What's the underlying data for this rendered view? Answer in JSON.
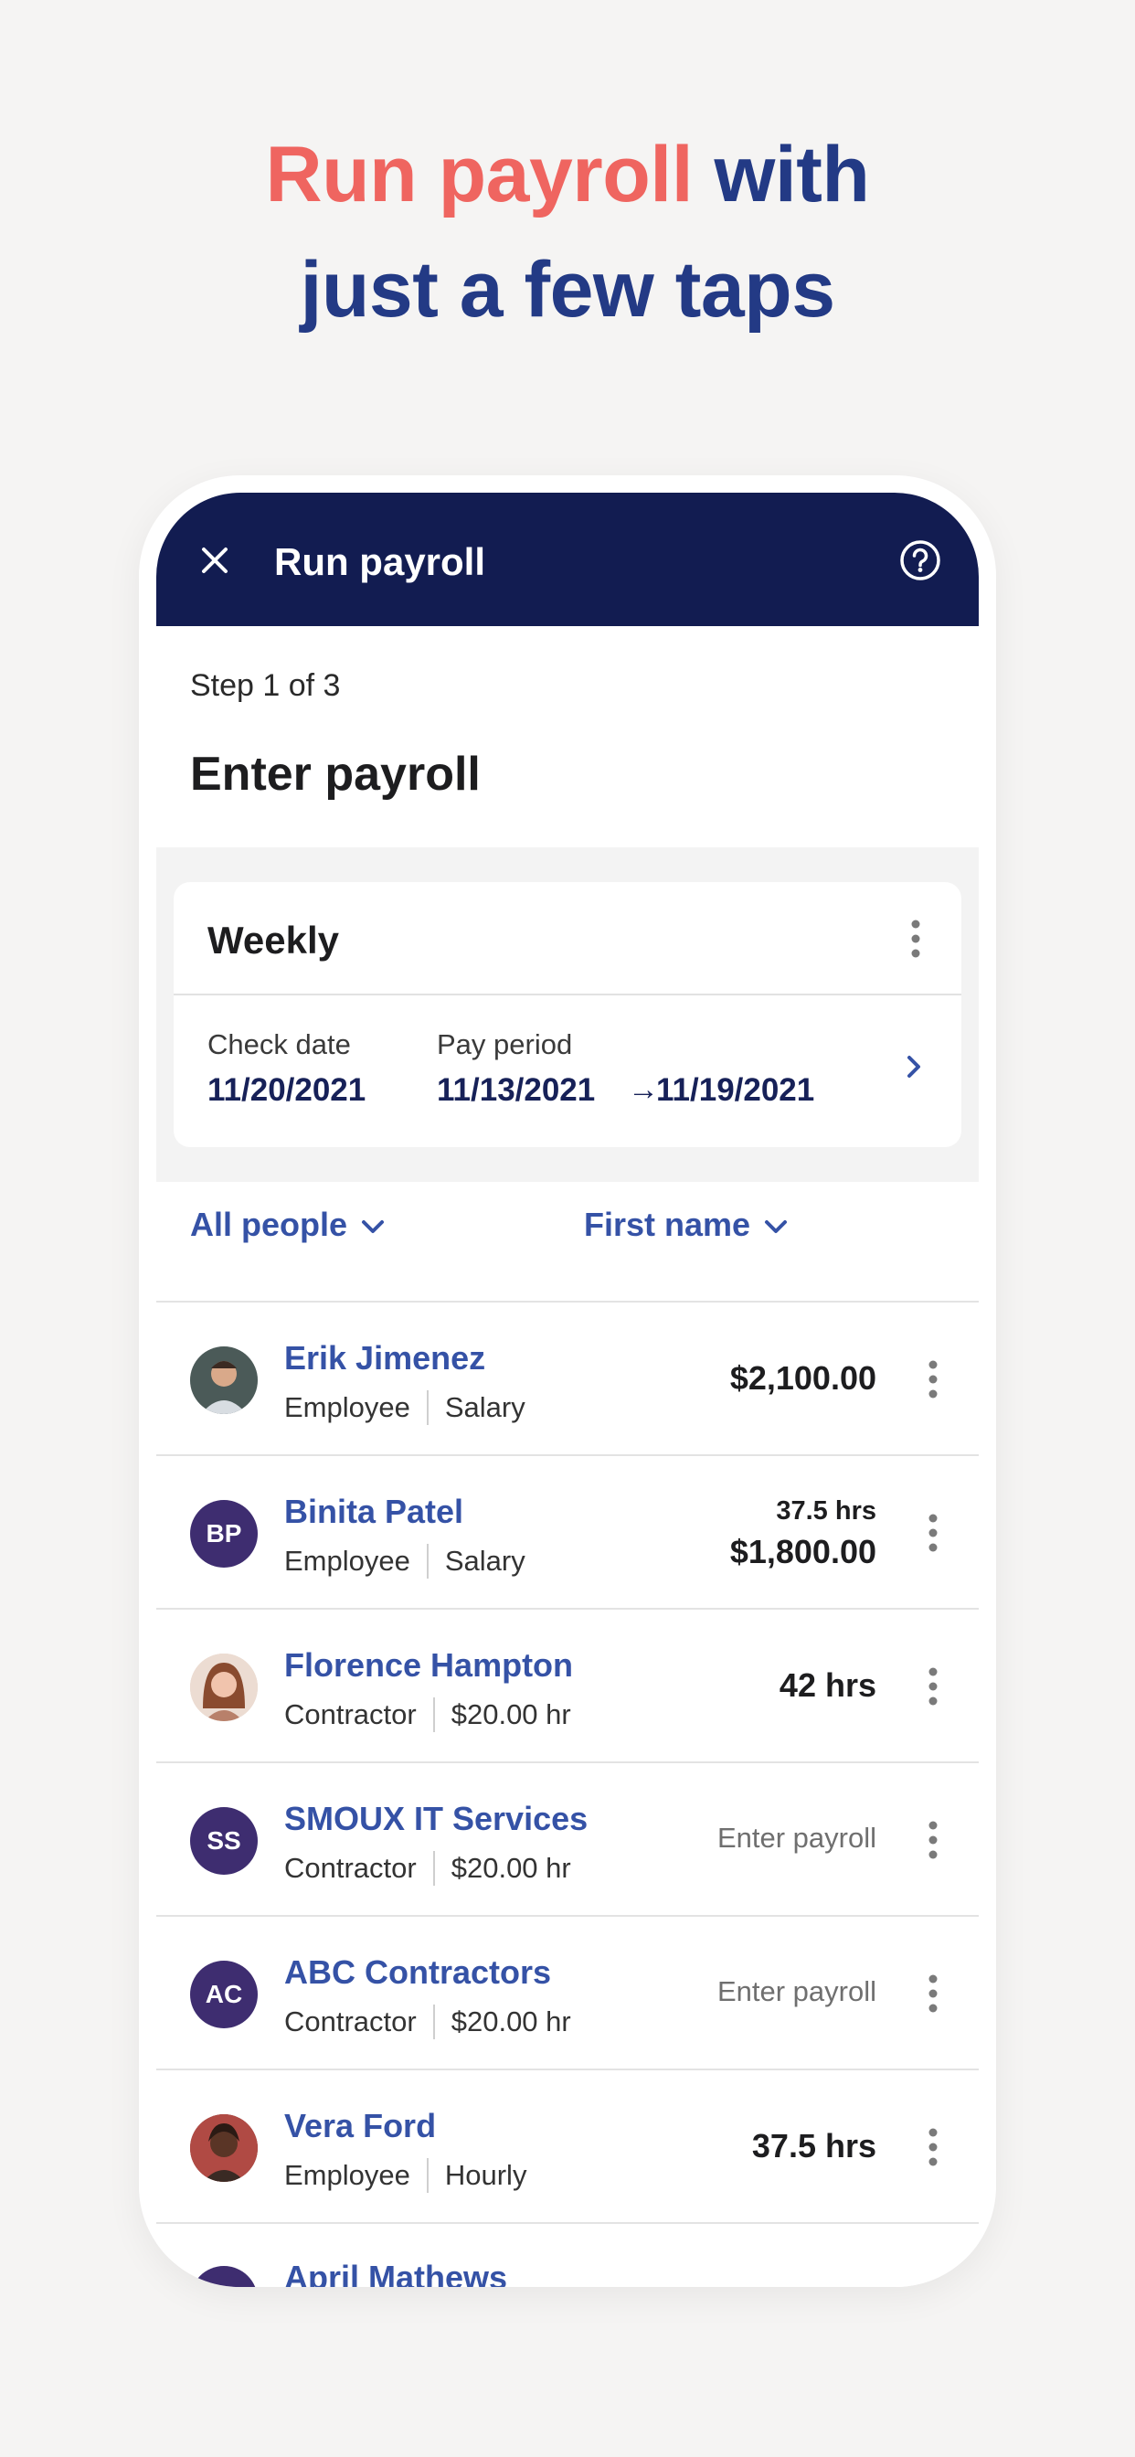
{
  "headline": {
    "accent": "Run payroll",
    "rest_line1": " with",
    "line2": "just a few taps"
  },
  "navbar": {
    "title": "Run payroll",
    "close_icon": "close-icon",
    "help_icon": "help-icon"
  },
  "step_label": "Step 1 of 3",
  "page_title": "Enter payroll",
  "pay_schedule": {
    "title": "Weekly",
    "check_date_label": "Check date",
    "check_date": "11/20/2021",
    "pay_period_label": "Pay period",
    "period_start": "11/13/2021",
    "arrow": "→",
    "period_end": "11/19/2021"
  },
  "filters": {
    "people": "All people",
    "sort": "First name"
  },
  "people": [
    {
      "name": "Erik Jimenez",
      "type": "Employee",
      "pay": "Salary",
      "avatar": "photo",
      "amount": "$2,100.00"
    },
    {
      "name": "Binita Patel",
      "type": "Employee",
      "pay": "Salary",
      "initials": "BP",
      "hours": "37.5 hrs",
      "amount": "$1,800.00"
    },
    {
      "name": "Florence Hampton",
      "type": "Contractor",
      "pay": "$20.00 hr",
      "avatar": "photo",
      "amount": "42 hrs"
    },
    {
      "name": "SMOUX IT Services",
      "type": "Contractor",
      "pay": "$20.00 hr",
      "initials": "SS",
      "action": "Enter payroll"
    },
    {
      "name": "ABC Contractors",
      "type": "Contractor",
      "pay": "$20.00 hr",
      "initials": "AC",
      "action": "Enter payroll"
    },
    {
      "name": "Vera Ford",
      "type": "Employee",
      "pay": "Hourly",
      "avatar": "photo",
      "amount": "37.5 hrs"
    },
    {
      "name": "April Mathews"
    }
  ],
  "colors": {
    "navy": "#121c51",
    "accent_red": "#ef6560",
    "link_blue": "#3552a6",
    "headline_blue": "#233a85"
  }
}
